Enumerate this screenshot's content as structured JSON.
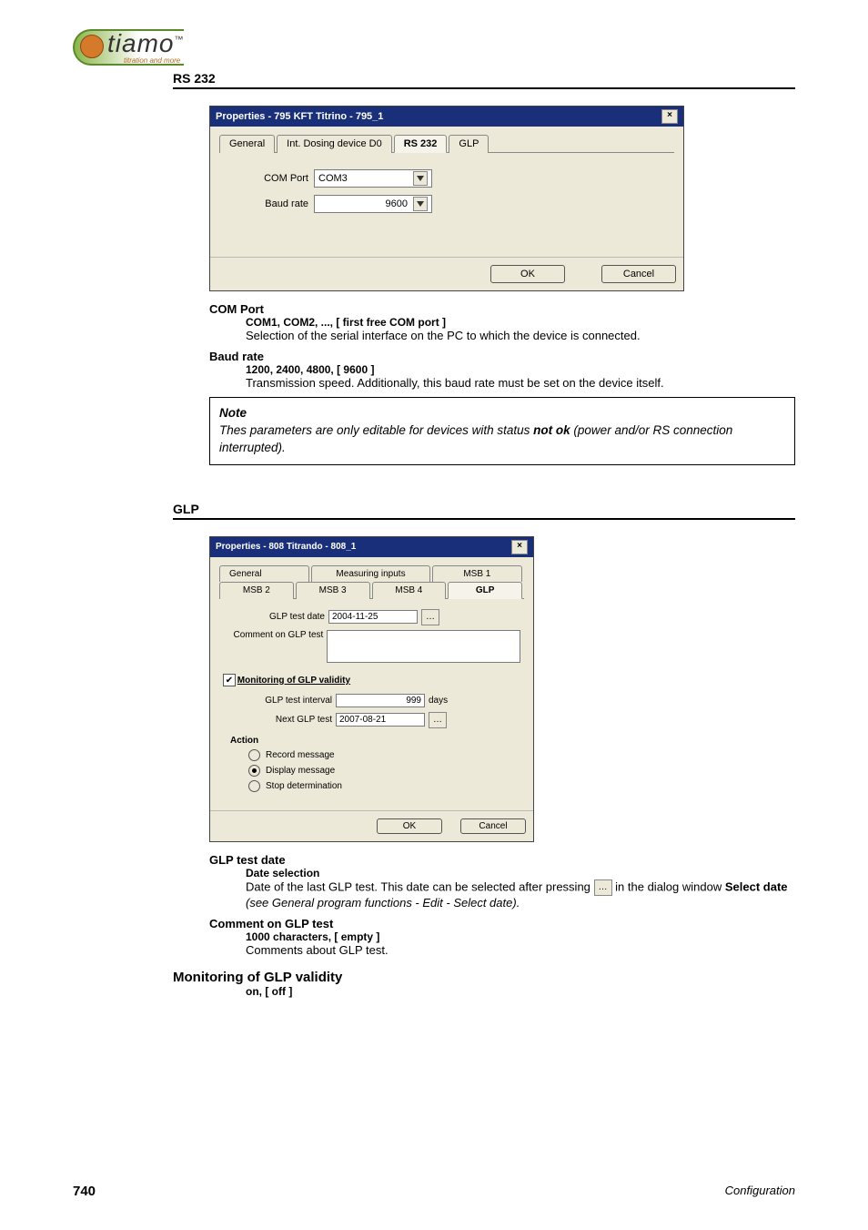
{
  "logo": {
    "text": "tiamo",
    "tm": "™",
    "sub": "titration and more"
  },
  "sections": {
    "rs232": {
      "title": "RS 232",
      "dialog": {
        "title": "Properties - 795 KFT Titrino - 795_1",
        "tabs": [
          "General",
          "Int. Dosing device D0",
          "RS 232",
          "GLP"
        ],
        "active_tab": "RS 232",
        "com_port_label": "COM Port",
        "com_port_value": "COM3",
        "baud_label": "Baud rate",
        "baud_value": "9600",
        "ok": "OK",
        "cancel": "Cancel"
      },
      "spec": {
        "com_port": {
          "name": "COM Port",
          "values": "COM1, COM2, ..., [ first free COM port ]",
          "desc": "Selection of the serial interface on the PC to which the device is connected."
        },
        "baud": {
          "name": "Baud rate",
          "values": "1200, 2400, 4800, [ 9600 ]",
          "desc": "Transmission speed. Additionally, this baud rate must be set on the device itself."
        }
      },
      "note": {
        "heading": "Note",
        "text_before": "Thes parameters are only editable for devices with status ",
        "bold": "not ok",
        "text_after": " (power and/or RS connection interrupted)."
      }
    },
    "glp": {
      "title": "GLP",
      "dialog": {
        "title": "Properties - 808 Titrando - 808_1",
        "tabs_top": [
          "General",
          "Measuring inputs",
          "MSB 1"
        ],
        "tabs_bottom": [
          "MSB 2",
          "MSB 3",
          "MSB 4",
          "GLP"
        ],
        "active_tab": "GLP",
        "glp_test_date_label": "GLP test date",
        "glp_test_date_value": "2004-11-25",
        "comment_label": "Comment on GLP test",
        "monitoring_label": "Monitoring of GLP validity",
        "monitoring_checked": true,
        "interval_label": "GLP test interval",
        "interval_value": "999",
        "interval_unit": "days",
        "next_label": "Next GLP test",
        "next_value": "2007-08-21",
        "action_label": "Action",
        "radios": {
          "record": "Record message",
          "display": "Display message",
          "stop": "Stop determination"
        },
        "selected_action": "display",
        "ok": "OK",
        "cancel": "Cancel"
      },
      "spec": {
        "date": {
          "name": "GLP test date",
          "values": "Date selection",
          "desc_pre": "Date of the last GLP test. This date can be selected after pressing ",
          "desc_mid": " in the dialog window ",
          "desc_bold": "Select date",
          "desc_post": " (see General program functions - Edit - Select date)."
        },
        "comment": {
          "name": "Comment on GLP test",
          "values": "1000 characters, [ empty ]",
          "desc": "Comments about GLP test."
        }
      },
      "subheading": "Monitoring of GLP validity",
      "onoff": "on, [ off ]"
    }
  },
  "footer": {
    "page": "740",
    "right": "Configuration"
  }
}
